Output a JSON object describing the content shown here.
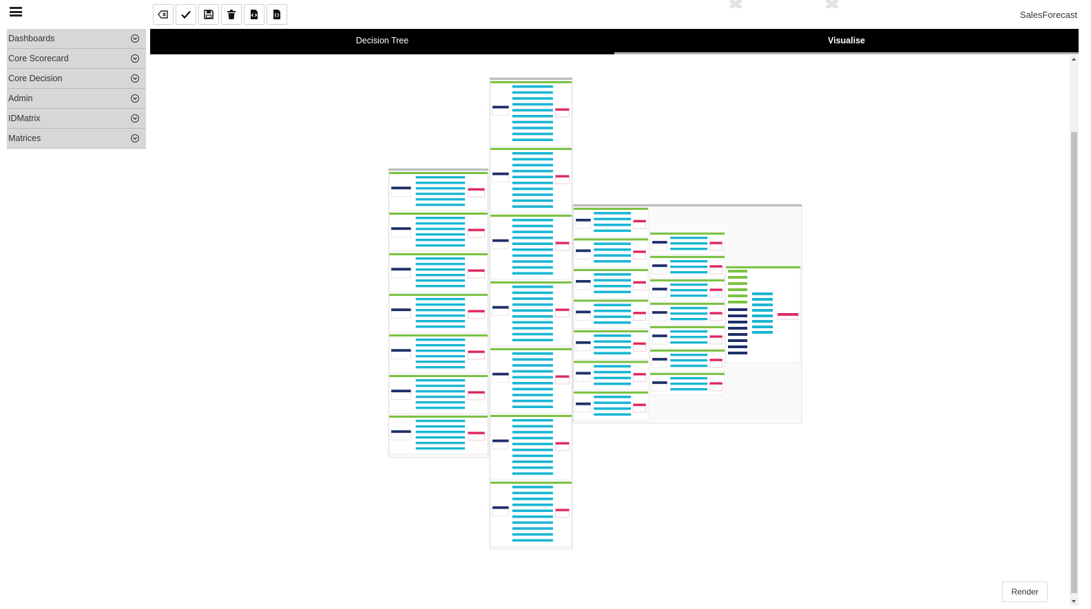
{
  "app": {
    "name": "SalesForecast"
  },
  "toolbar": {
    "buttons": [
      {
        "icon": "clear-icon",
        "name": "clear-button"
      },
      {
        "icon": "check-icon",
        "name": "validate-button"
      },
      {
        "icon": "save-icon",
        "name": "save-button"
      },
      {
        "icon": "trash-icon",
        "name": "delete-button"
      },
      {
        "icon": "export-code-icon",
        "name": "export-button"
      },
      {
        "icon": "import-json-icon",
        "name": "import-button"
      }
    ]
  },
  "sidebar": {
    "items": [
      {
        "label": "Dashboards"
      },
      {
        "label": "Core Scorecard"
      },
      {
        "label": "Core Decision"
      },
      {
        "label": "Admin"
      },
      {
        "label": "IDMatrix"
      },
      {
        "label": "Matrices"
      }
    ]
  },
  "tabs": [
    {
      "label": "Decision Tree",
      "active": false
    },
    {
      "label": "Visualise",
      "active": true
    }
  ],
  "render": {
    "label": "Render"
  },
  "colors": {
    "green": "#7cc242",
    "cyan": "#1ab6d4",
    "navy": "#1d2f6b",
    "red": "#e0245e",
    "frame": "#cfcfcf"
  }
}
